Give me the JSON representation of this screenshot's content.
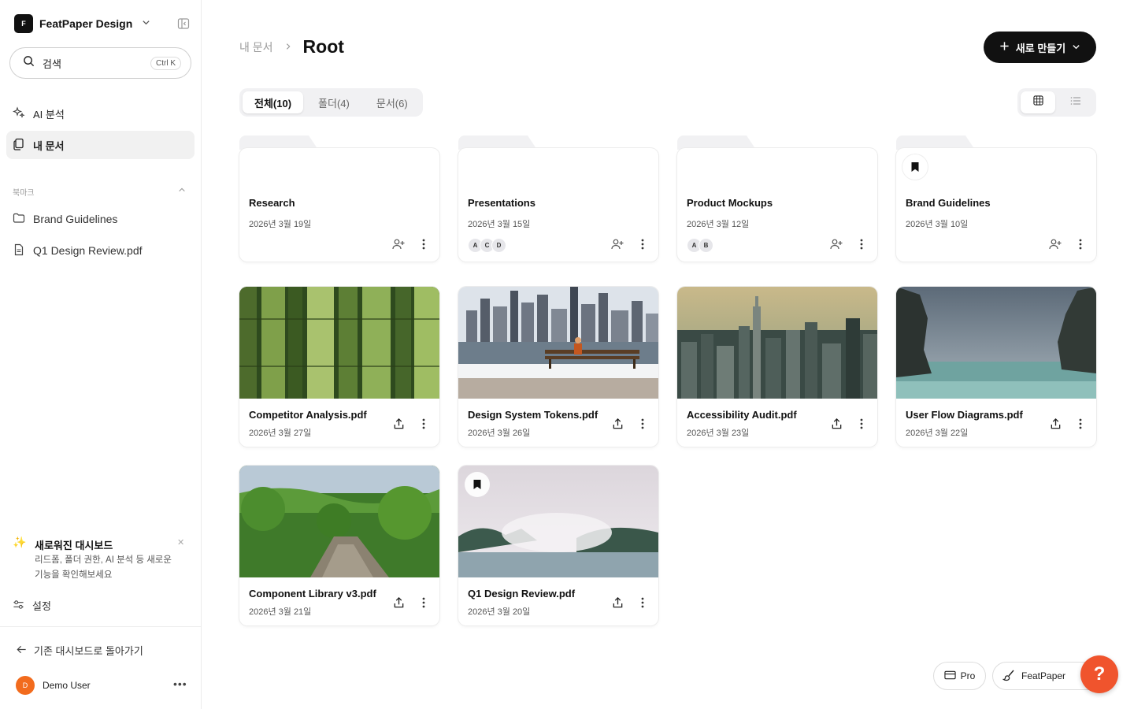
{
  "workspace": {
    "logo_letter": "F",
    "name": "FeatPaper Design"
  },
  "search": {
    "label": "검색",
    "shortcut": "Ctrl K"
  },
  "nav": [
    {
      "label": "AI 분석"
    },
    {
      "label": "내 문서"
    }
  ],
  "bookmarks": {
    "section_label": "북마크",
    "items": [
      {
        "label": "Brand Guidelines",
        "icon": "folder-icon"
      },
      {
        "label": "Q1 Design Review.pdf",
        "icon": "document-icon"
      }
    ]
  },
  "promo": {
    "title": "새로워진 대시보드",
    "description": "리드폼, 폴더 권한, AI 분석 등 새로운 기능을 확인해보세요"
  },
  "settings_label": "설정",
  "back_link": "기존 대시보드로 돌아가기",
  "user": {
    "initial": "D",
    "name": "Demo User"
  },
  "breadcrumb": {
    "parent": "내 문서",
    "current": "Root"
  },
  "new_button": "새로 만들기",
  "tabs": [
    {
      "label": "전체(10)"
    },
    {
      "label": "폴더(4)"
    },
    {
      "label": "문서(6)"
    }
  ],
  "folders": [
    {
      "name": "Research",
      "date": "2026년 3월 19일",
      "avatars": []
    },
    {
      "name": "Presentations",
      "date": "2026년 3월 15일",
      "avatars": [
        "A",
        "C",
        "D"
      ]
    },
    {
      "name": "Product Mockups",
      "date": "2026년 3월 12일",
      "avatars": [
        "A",
        "B"
      ]
    },
    {
      "name": "Brand Guidelines",
      "date": "2026년 3월 10일",
      "avatars": []
    }
  ],
  "documents": [
    {
      "name": "Competitor Analysis.pdf",
      "date": "2026년 3월 27일"
    },
    {
      "name": "Design System Tokens.pdf",
      "date": "2026년 3월 26일"
    },
    {
      "name": "Accessibility Audit.pdf",
      "date": "2026년 3월 23일"
    },
    {
      "name": "User Flow Diagrams.pdf",
      "date": "2026년 3월 22일"
    },
    {
      "name": "Component Library v3.pdf",
      "date": "2026년 3월 21일"
    },
    {
      "name": "Q1 Design Review.pdf",
      "date": "2026년 3월 20일"
    }
  ],
  "floating": {
    "pro_label": "Pro",
    "brand_label": "FeatPaper",
    "help_label": "?"
  },
  "colors": {
    "primary": "#111111",
    "help": "#f0542d",
    "avatar": "#f26b1d"
  }
}
